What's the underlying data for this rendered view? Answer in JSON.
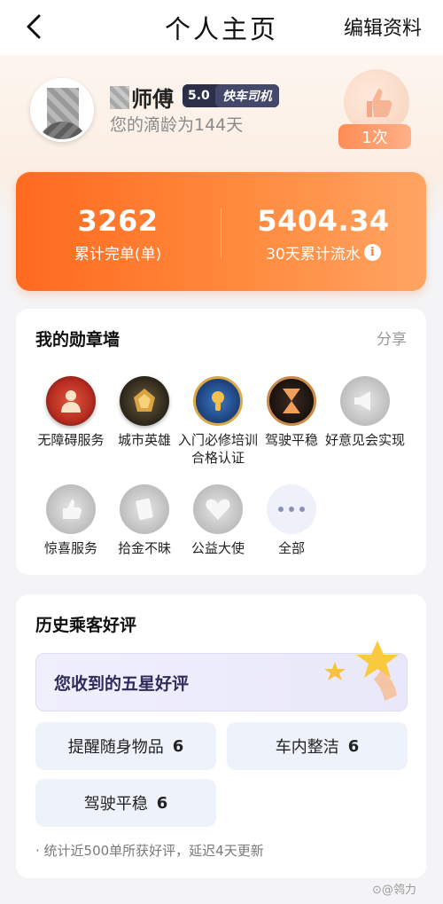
{
  "header": {
    "title": "个人主页",
    "edit_label": "编辑资料"
  },
  "profile": {
    "name": "师傅",
    "score": "5.0",
    "car_type": "快车司机",
    "tenure": "您的滴龄为144天",
    "like_count": "1次"
  },
  "stats": {
    "orders_value": "3262",
    "orders_label": "累计完单(单)",
    "income_value": "5404.34",
    "income_label": "30天累计流水",
    "info_icon": "i"
  },
  "medals": {
    "title": "我的勋章墙",
    "share": "分享",
    "items": [
      {
        "label": "无障碍服务",
        "icon": "accessibility-medal-icon",
        "earned": true
      },
      {
        "label": "城市英雄",
        "icon": "city-hero-medal-icon",
        "earned": true
      },
      {
        "label": "入门必修培训合格认证",
        "icon": "training-cert-medal-icon",
        "earned": true
      },
      {
        "label": "驾驶平稳",
        "icon": "steady-driving-medal-icon",
        "earned": true
      },
      {
        "label": "好意见会实现",
        "icon": "megaphone-medal-icon",
        "earned": false
      },
      {
        "label": "惊喜服务",
        "icon": "thumbs-up-medal-icon",
        "earned": false
      },
      {
        "label": "拾金不昧",
        "icon": "honesty-medal-icon",
        "earned": false
      },
      {
        "label": "公益大使",
        "icon": "heart-medal-icon",
        "earned": false
      },
      {
        "label": "全部",
        "icon": "more-icon",
        "earned": false
      }
    ]
  },
  "reviews": {
    "title": "历史乘客好评",
    "five_star": "您收到的五星好评",
    "tags": [
      {
        "label": "提醒随身物品",
        "count": "6"
      },
      {
        "label": "车内整洁",
        "count": "6"
      },
      {
        "label": "驾驶平稳",
        "count": "6"
      }
    ],
    "footnote": "· 统计近500单所获好评，延迟4天更新"
  },
  "colors": {
    "accent_orange": "#ff7a35",
    "badge_dark": "#2b2f4a",
    "tag_bg": "#eef2fb"
  },
  "watermark": "⊙@鸰力"
}
